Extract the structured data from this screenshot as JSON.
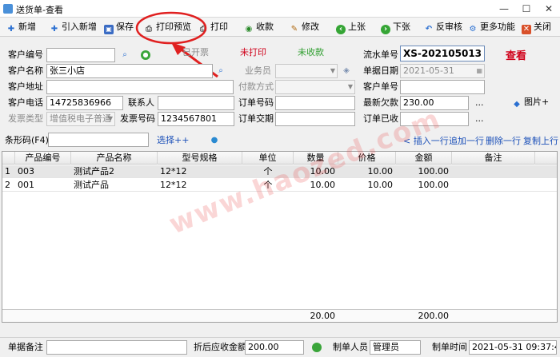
{
  "window": {
    "title": "送货单-查看",
    "minimize": "—",
    "maximize": "☐",
    "close": "✕"
  },
  "toolbar": {
    "new": "新增",
    "import_new": "引入新增",
    "save": "保存",
    "print_preview": "打印预览",
    "print": "打印",
    "collect": "收款",
    "modify": "修改",
    "prev": "上张",
    "next": "下张",
    "reverse_audit": "反审核",
    "more": "更多功能",
    "close": "关闭"
  },
  "status": {
    "invoice": "已开票",
    "print": "未打印",
    "payment": "未收款",
    "mode": "查看"
  },
  "form": {
    "customer_code_label": "客户编号",
    "customer_code": "",
    "customer_name_label": "客户名称",
    "customer_name": "张三小店",
    "customer_address_label": "客户地址",
    "customer_address": "",
    "customer_phone_label": "客户电话",
    "customer_phone": "14725836966",
    "contact_label": "联系人",
    "contact": "",
    "invoice_type_label": "发票类型",
    "invoice_type": "增值税电子普通",
    "invoice_no_label": "发票号码",
    "invoice_no": "1234567801",
    "salesman_label": "业务员",
    "salesman": "",
    "payment_method_label": "付款方式",
    "payment_method": "",
    "order_code_label": "订单号码",
    "order_code": "",
    "order_delivery_label": "订单交期",
    "order_delivery": "",
    "serial_label": "流水单号",
    "serial": "XS-202105013",
    "doc_date_label": "单据日期",
    "doc_date": "2021-05-31",
    "customer_order_label": "客户单号",
    "customer_order": "",
    "latest_debt_label": "最新欠款",
    "latest_debt": "230.00",
    "order_received_label": "订单已收",
    "order_received": "",
    "image_btn": "图片+",
    "ellipsis": "..."
  },
  "barcode": {
    "label": "条形码(F4)",
    "value": "",
    "select": "选择++",
    "insert_row": "< 插入一行",
    "append_row": "追加一行",
    "delete_row": "删除一行",
    "copy_row": "复制上行"
  },
  "table": {
    "headers": [
      "产品编号",
      "产品名称",
      "型号规格",
      "单位",
      "数量",
      "价格",
      "金额",
      "备注"
    ],
    "rows": [
      {
        "idx": "1",
        "code": "003",
        "name": "测试产品2",
        "spec": "12*12",
        "unit": "个",
        "qty": "10.00",
        "price": "10.00",
        "amount": "100.00",
        "remark": ""
      },
      {
        "idx": "2",
        "code": "001",
        "name": "测试产品",
        "spec": "12*12",
        "unit": "个",
        "qty": "10.00",
        "price": "10.00",
        "amount": "100.00",
        "remark": ""
      }
    ],
    "total_qty": "20.00",
    "total_amount": "200.00"
  },
  "footer": {
    "remark_label": "单据备注",
    "remark": "",
    "discount_label": "折后应收金额",
    "discount": "200.00",
    "maker_label": "制单人员",
    "maker": "管理员",
    "time_label": "制单时间",
    "time": "2021-05-31 09:37:47"
  },
  "watermark": "www.haozed.com",
  "colors": {
    "status_red": "#d0021b",
    "status_green": "#2f9e2f",
    "annotation_red": "#e02020"
  }
}
